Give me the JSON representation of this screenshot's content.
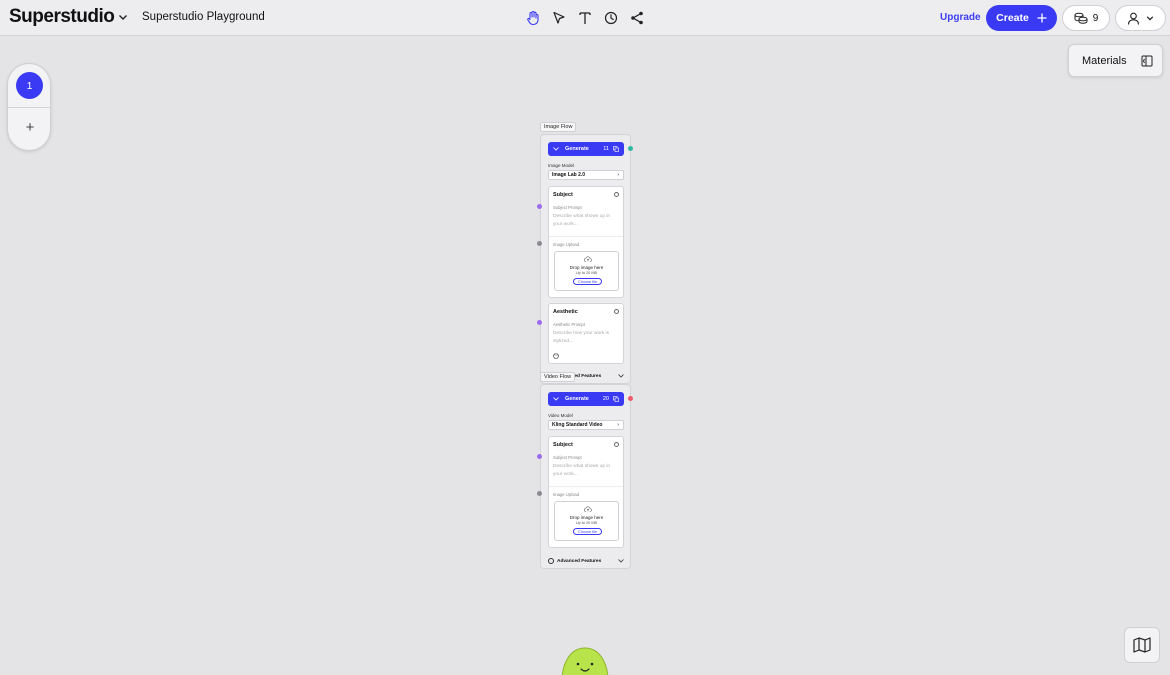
{
  "header": {
    "logo": "Superstudio",
    "project_title": "Superstudio Playground",
    "tools": [
      "hand-icon",
      "pointer-icon",
      "text-icon",
      "history-icon",
      "share-icon"
    ],
    "upgrade_label": "Upgrade",
    "create_label": "Create",
    "credits": "9"
  },
  "sidebar": {
    "canvas_number": "1",
    "add_label": "+"
  },
  "materials": {
    "label": "Materials"
  },
  "image_flow": {
    "tag": "Image Flow",
    "generate_label": "Generate",
    "generate_count": "11",
    "model_label": "Image Model",
    "model_value": "Image Lab 2.0",
    "subject": {
      "title": "Subject",
      "prompt_label": "Subject Prompt",
      "placeholder": "Describe what shows up in your work...",
      "upload_label": "Image Upload",
      "drop_text": "Drop image here",
      "size_text": "Up to 20 MB",
      "choose_label": "Choose file"
    },
    "aesthetic": {
      "title": "Aesthetic",
      "prompt_label": "Aesthetic Prompt",
      "placeholder": "Describe how your work is stylized..."
    },
    "advanced_label": "Advanced Features"
  },
  "video_flow": {
    "tag": "Video Flow",
    "generate_label": "Generate",
    "generate_count": "20",
    "model_label": "Video Model",
    "model_value": "Kling Standard Video",
    "subject": {
      "title": "Subject",
      "prompt_label": "Subject Prompt",
      "placeholder": "Describe what shows up in your work...",
      "upload_label": "Image Upload",
      "drop_text": "Drop image here",
      "size_text": "Up to 20 MB",
      "choose_label": "Choose file"
    },
    "advanced_label": "Advanced Features"
  },
  "colors": {
    "accent": "#3a3af4",
    "canvas": "#e4e4e6",
    "handle_teal": "#2cb8a0",
    "handle_purple": "#9b6bf0",
    "handle_gray": "#8a8a90",
    "handle_red": "#f05a6a",
    "mascot": "#b9e34a"
  }
}
